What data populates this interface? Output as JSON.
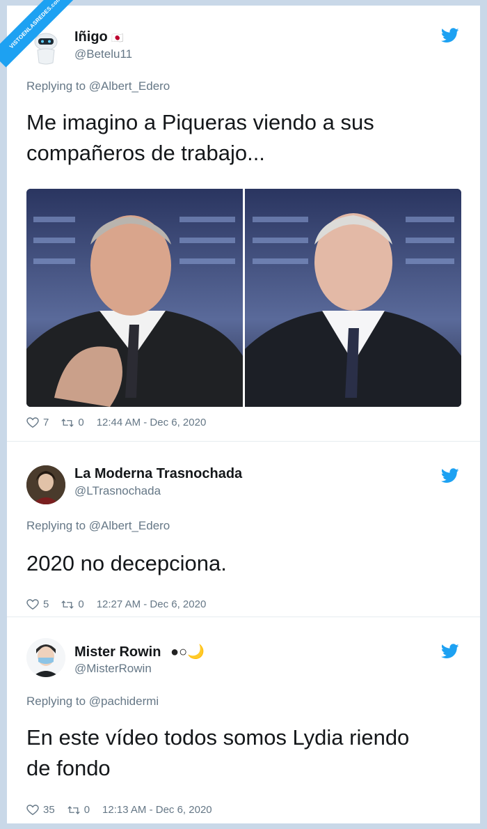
{
  "watermark": "VISTOENLASREDES.com",
  "colors": {
    "twitter_blue": "#1da1f2",
    "text": "#14171a",
    "secondary": "#657786"
  },
  "tweets": [
    {
      "name": "Iñigo",
      "name_emoji": "🇯🇵",
      "handle": "@Betelu11",
      "replying": "Replying to @Albert_Edero",
      "text_lines": [
        "Me imagino a Piqueras viendo a sus",
        "compañeros de trabajo..."
      ],
      "likes": "7",
      "retweets": "0",
      "timestamp": "12:44 AM - Dec 6, 2020"
    },
    {
      "name": "La Moderna Trasnochada",
      "handle": "@LTrasnochada",
      "replying": "Replying to @Albert_Edero",
      "text_lines": [
        "2020 no decepciona."
      ],
      "likes": "5",
      "retweets": "0",
      "timestamp": "12:27 AM - Dec 6, 2020"
    },
    {
      "name": "Mister Rowin",
      "name_emoji": "●○🌙",
      "handle": "@MisterRowin",
      "replying": "Replying to @pachidermi",
      "text_lines": [
        "En este vídeo todos somos Lydia riendo",
        "de fondo"
      ],
      "likes": "35",
      "retweets": "0",
      "timestamp": "12:13 AM - Dec 6, 2020"
    }
  ]
}
